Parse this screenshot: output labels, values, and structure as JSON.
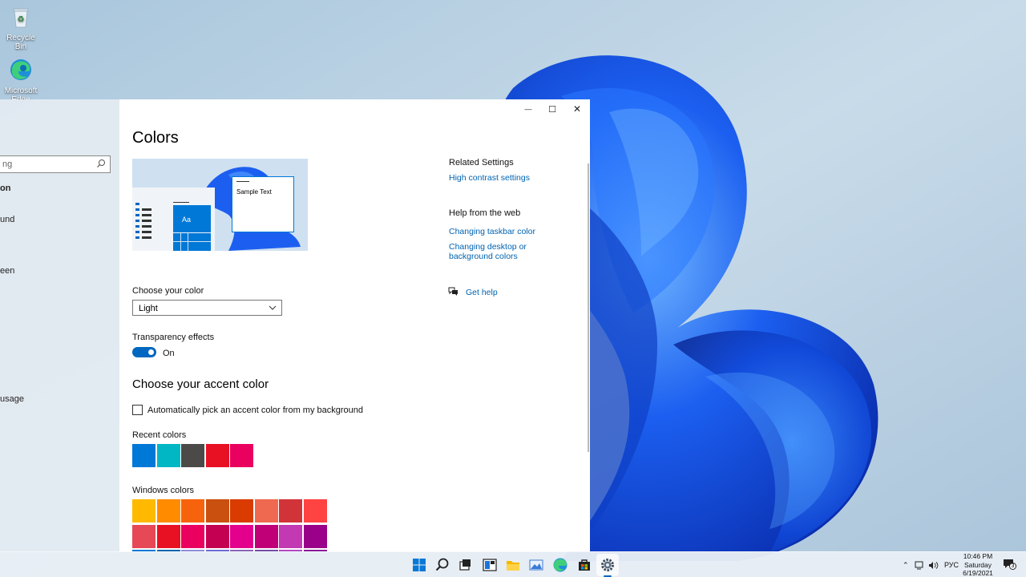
{
  "desktop": {
    "icons": [
      {
        "name": "recycle-bin",
        "label": "Recycle Bin"
      },
      {
        "name": "microsoft-edge",
        "label_line1": "Microsoft",
        "label_line2": "Edge"
      }
    ]
  },
  "sidebar": {
    "search_value": "ng",
    "items": [
      {
        "label": "on",
        "bold": true
      },
      {
        "label": "und"
      },
      {
        "label": "een"
      },
      {
        "label": "usage"
      }
    ]
  },
  "window": {
    "controls": {
      "minimize": "—",
      "maximize": "☐",
      "close": "✕"
    },
    "page_title": "Colors",
    "preview": {
      "sample_text": "Sample Text",
      "tile_text": "Aa"
    },
    "choose_color": {
      "label": "Choose your color",
      "value": "Light"
    },
    "transparency": {
      "label": "Transparency effects",
      "state_label": "On",
      "on": true
    },
    "accent": {
      "title": "Choose your accent color",
      "auto_pick_label": "Automatically pick an accent color from my background",
      "auto_pick_checked": false,
      "recent_label": "Recent colors",
      "recent_colors": [
        "#0078d7",
        "#00b7c3",
        "#4c4a48",
        "#e81123",
        "#ea005e"
      ],
      "windows_label": "Windows colors",
      "windows_colors": [
        [
          "#ffb900",
          "#ff8c00",
          "#f7630c",
          "#ca5010",
          "#da3b01",
          "#ef6950",
          "#d13438",
          "#ff4343"
        ],
        [
          "#e74856",
          "#e81123",
          "#ea005e",
          "#c30052",
          "#e3008c",
          "#bf0077",
          "#c239b3",
          "#9a0089"
        ],
        [
          "#0078d7",
          "#0063b1",
          "#8e8cd8",
          "#6b69d6",
          "#8764b8",
          "#744da9",
          "#b146c2",
          "#881798"
        ]
      ]
    },
    "related": {
      "heading": "Related Settings",
      "links": [
        "High contrast settings"
      ]
    },
    "help_web": {
      "heading": "Help from the web",
      "links": [
        "Changing taskbar color",
        "Changing desktop or background colors"
      ]
    },
    "get_help": "Get help"
  },
  "taskbar": {
    "apps": [
      "start",
      "search",
      "task-view",
      "widgets",
      "file-explorer",
      "photos",
      "edge",
      "store",
      "settings"
    ],
    "language": "РУС",
    "clock": {
      "time": "10:46 PM",
      "day": "Saturday",
      "date": "6/19/2021"
    },
    "notification_count": "3"
  },
  "colors": {
    "accent": "#0067c0",
    "link": "#0063b1"
  }
}
